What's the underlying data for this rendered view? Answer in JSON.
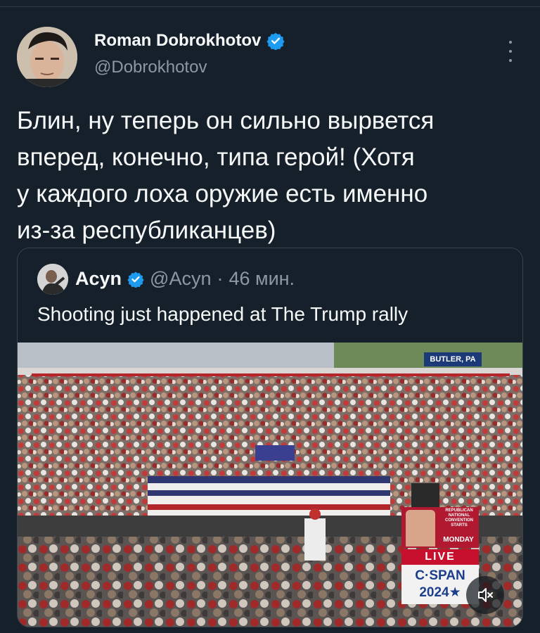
{
  "author": {
    "display_name": "Roman Dobrokhotov",
    "handle": "@Dobrokhotov",
    "verified_icon": "verified-badge-icon"
  },
  "tweet": {
    "text": "Блин, ну теперь он сильно вырвется\nвперед, конечно, типа герой! (Хотя\nу каждого лоха оружие есть именно\nиз-за республиканцев)"
  },
  "more_icon": "more-options-icon",
  "quote": {
    "author": {
      "display_name": "Acyn",
      "handle": "@Acyn",
      "separator": "·",
      "time": "46 мин."
    },
    "text": "Shooting just happened at The Trump rally",
    "media": {
      "location_label": "BUTLER, PA",
      "event_lines": "REPUBLICAN NATIONAL CONVENTION STARTS",
      "event_day": "MONDAY",
      "live_label": "LIVE",
      "network_label": "C·SPAN",
      "network_year": "2024★",
      "mute_icon": "volume-muted-icon"
    }
  },
  "colors": {
    "background": "#15202b",
    "text": "#f7f9f9",
    "secondary_text": "#8b98a5",
    "border": "#38444d",
    "verified": "#1d9bf0"
  }
}
